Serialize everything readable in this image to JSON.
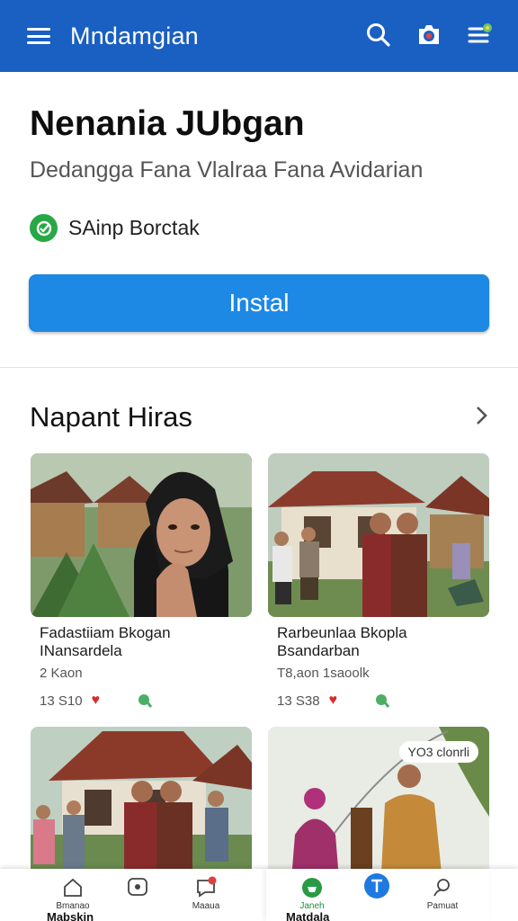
{
  "topbar": {
    "title": "Mndamgian",
    "menu_icon": "hamburger-menu-icon",
    "actions": [
      "search-icon",
      "camera-icon",
      "notifications-list-icon"
    ]
  },
  "app": {
    "name": "Nenania JUbgan",
    "subtitle": "Dedangga Fana Vlalraa Fana Avidarian",
    "verified_label": "SAinp Borctak",
    "install_label": "Instal"
  },
  "section": {
    "title": "Napant Hiras"
  },
  "cards": [
    {
      "title_line1": "Fadastiiam Bkogan",
      "title_line2": "INansardela",
      "meta": "2 Kaon",
      "stat": "13 S10"
    },
    {
      "title_line1": "Rarbeunlaa Bkopla",
      "title_line2": "Bsandarban",
      "meta": "T8,aon 1saoolk",
      "stat": "13 S38"
    },
    {
      "title_line1": "",
      "title_line2": "",
      "meta": "",
      "stat": ""
    },
    {
      "badge": "YO3 clonrli",
      "title_line1": "",
      "title_line2": "",
      "meta": "",
      "stat": ""
    }
  ],
  "bottom_nav": {
    "items": [
      {
        "label": "Bmanao",
        "icon": "home-icon"
      },
      {
        "label": "",
        "icon": "chat-icon"
      },
      {
        "label": "Maaua",
        "icon": "notification-icon"
      },
      {
        "label": "Janeh",
        "icon": "games-icon"
      },
      {
        "label": "",
        "icon": "profile-circle-icon"
      },
      {
        "label": "Pamuat",
        "icon": "more-icon"
      }
    ],
    "bottom_text_left": "Mabskin",
    "bottom_text_right": "Matdala"
  },
  "colors": {
    "topbar": "#1a5fc2",
    "install": "#1e88e5",
    "verified": "#27a844",
    "heart": "#d62b2b"
  }
}
